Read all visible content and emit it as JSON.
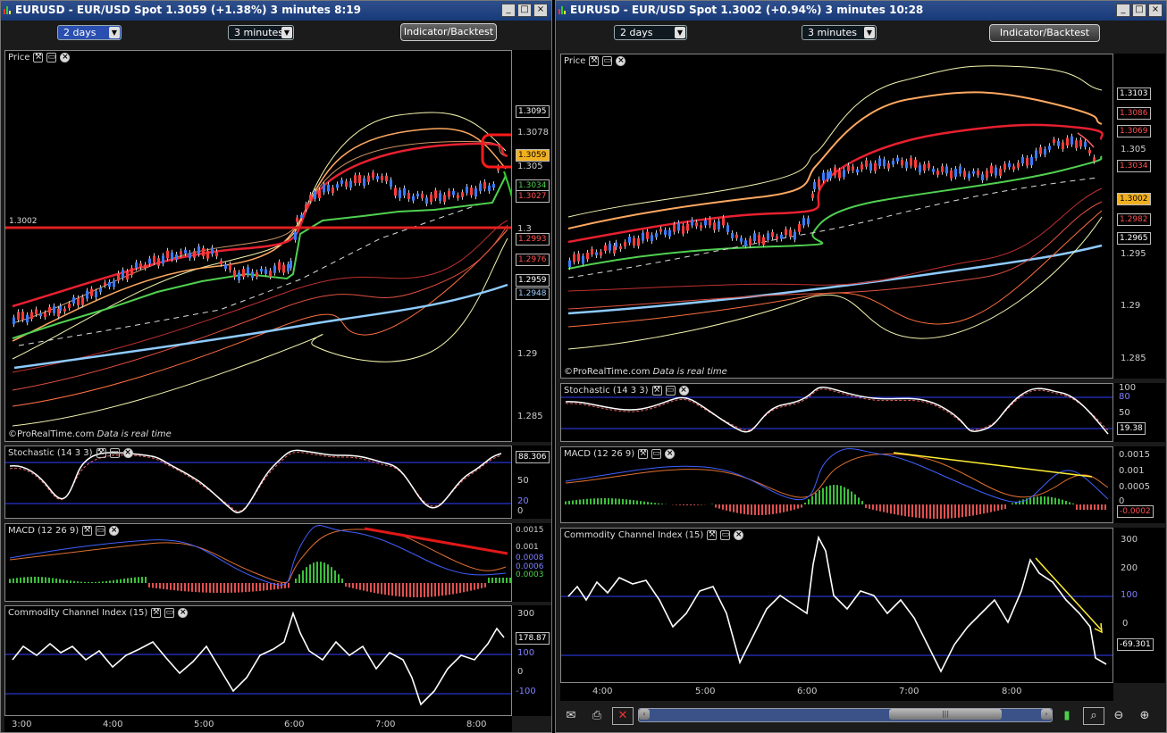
{
  "left": {
    "title": "EURUSD - EUR/USD Spot   1.3059 (+1.38%)   3 minutes  8:19",
    "period": "2 days",
    "interval": "3 minutes",
    "button": "Indicator/Backtest",
    "price_panel": {
      "title": "Price"
    },
    "credit": "©ProRealTime.com",
    "credit_note": "Data is real time",
    "hline_label": "1.3002",
    "y_ticks": [
      "1.3078",
      "1.305",
      "1.3",
      "1.29",
      "1.285"
    ],
    "tags": [
      {
        "v": "1.3095",
        "c": "#ffffff"
      },
      {
        "v": "1.3059",
        "c": "#000000",
        "bg": "#f0b020"
      },
      {
        "v": "1.3034",
        "c": "#4cd04c"
      },
      {
        "v": "1.3027",
        "c": "#ff5050"
      },
      {
        "v": "1.2993",
        "c": "#ff5050"
      },
      {
        "v": "1.2976",
        "c": "#ff5050"
      },
      {
        "v": "1.2959",
        "c": "#ffffff"
      },
      {
        "v": "1.2948",
        "c": "#9fd0ff"
      }
    ],
    "stoch": {
      "title": "Stochastic (14 3 3)",
      "value": "88.306",
      "ticks": [
        "50",
        "20",
        "0"
      ]
    },
    "macd": {
      "title": "MACD (12 26 9)",
      "ticks": [
        "0.0015",
        "0.001",
        "0.0008",
        "0.0006",
        "0.0003"
      ]
    },
    "cci": {
      "title": "Commodity Channel Index (15)",
      "value": "178.87",
      "ticks": [
        "300",
        "100",
        "0",
        "-100"
      ]
    },
    "time_ticks": [
      "3:00",
      "4:00",
      "5:00",
      "6:00",
      "7:00",
      "8:00"
    ]
  },
  "right": {
    "title": "EURUSD - EUR/USD Spot   1.3002 (+0.94%)   3 minutes  10:28",
    "period": "2 days",
    "interval": "3 minutes",
    "button": "Indicator/Backtest",
    "price_panel": {
      "title": "Price"
    },
    "credit": "©ProRealTime.com",
    "credit_note": "Data is real time",
    "y_ticks": [
      "1.305",
      "1.295",
      "1.29",
      "1.285"
    ],
    "tags": [
      {
        "v": "1.3103",
        "c": "#ffffff"
      },
      {
        "v": "1.3086",
        "c": "#ff5050"
      },
      {
        "v": "1.3069",
        "c": "#ff5050"
      },
      {
        "v": "1.3034",
        "c": "#ff5050"
      },
      {
        "v": "1.3002",
        "c": "#000000",
        "bg": "#f0b020"
      },
      {
        "v": "1.2982",
        "c": "#ff5050"
      },
      {
        "v": "1.2965",
        "c": "#ffffff"
      }
    ],
    "stoch": {
      "title": "Stochastic (14 3 3)",
      "value": "19.38",
      "ticks": [
        "100",
        "80",
        "50"
      ]
    },
    "macd": {
      "title": "MACD (12 26 9)",
      "value": "-0.0002",
      "ticks": [
        "0.0015",
        "0.001",
        "0.0005",
        "0"
      ]
    },
    "cci": {
      "title": "Commodity Channel Index (15)",
      "value": "-69.301",
      "ticks": [
        "300",
        "200",
        "100",
        "0"
      ]
    },
    "time_ticks": [
      "4:00",
      "5:00",
      "6:00",
      "7:00",
      "8:00"
    ]
  },
  "colors": {
    "titlebar": "#1f4080",
    "up": "#3a7bff",
    "down": "#ff3b3b",
    "sma": "#8ecbff"
  }
}
